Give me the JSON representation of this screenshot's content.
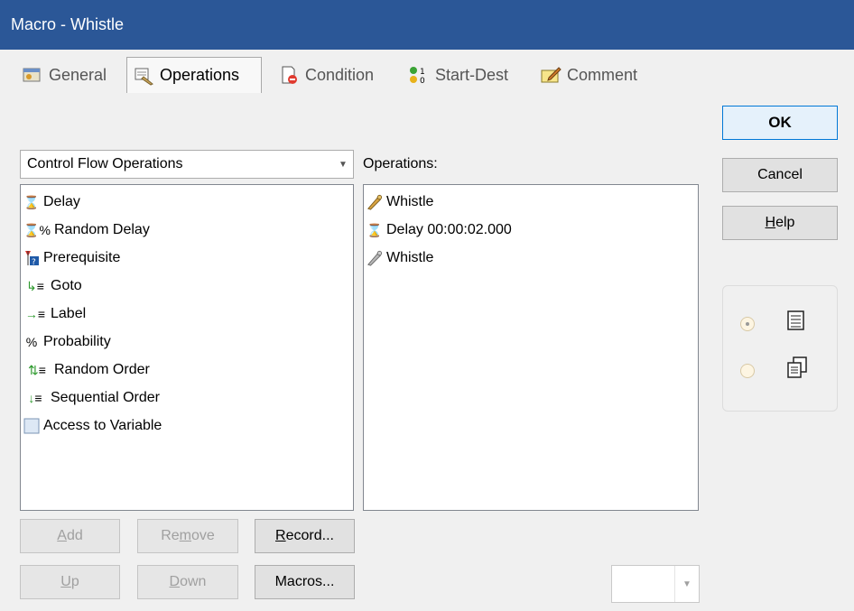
{
  "window": {
    "title": "Macro - Whistle"
  },
  "tabs": [
    {
      "label": "General",
      "icon": "general-icon"
    },
    {
      "label": "Operations",
      "icon": "operations-icon",
      "active": true
    },
    {
      "label": "Condition",
      "icon": "condition-icon"
    },
    {
      "label": "Start-Dest",
      "icon": "start-dest-icon"
    },
    {
      "label": "Comment",
      "icon": "comment-icon"
    }
  ],
  "category_combo": {
    "value": "Control Flow Operations"
  },
  "available_ops": [
    {
      "label": "Delay",
      "icon": "hourglass-icon"
    },
    {
      "label": "Random Delay",
      "icon": "random-delay-icon"
    },
    {
      "label": "Prerequisite",
      "icon": "prerequisite-icon"
    },
    {
      "label": "Goto",
      "icon": "goto-icon"
    },
    {
      "label": "Label",
      "icon": "label-icon"
    },
    {
      "label": "Probability",
      "icon": "percent-icon"
    },
    {
      "label": "Random Order",
      "icon": "random-order-icon"
    },
    {
      "label": "Sequential Order",
      "icon": "sequential-order-icon"
    },
    {
      "label": "Access to Variable",
      "icon": "variable-icon"
    }
  ],
  "operations_label": "Operations:",
  "operations": [
    {
      "label": "Whistle",
      "icon": "whistle-icon"
    },
    {
      "label": "Delay 00:00:02.000",
      "icon": "hourglass-icon"
    },
    {
      "label": "Whistle",
      "icon": "whistle-icon"
    }
  ],
  "buttons": {
    "ok": "OK",
    "cancel": "Cancel",
    "help_prefix": "",
    "help_mnemonic": "H",
    "help_rest": "elp",
    "add_mnemonic": "A",
    "add_rest": "dd",
    "remove_pre": "Re",
    "remove_mnemonic": "m",
    "remove_rest": "ove",
    "record_mnemonic": "R",
    "record_rest": "ecord...",
    "up_mnemonic": "U",
    "up_rest": "p",
    "down_mnemonic": "D",
    "down_rest": "own",
    "macros": "Macros..."
  },
  "view_mode": {
    "options": [
      {
        "icon": "list-view-icon",
        "selected": true
      },
      {
        "icon": "multi-page-view-icon",
        "selected": false
      }
    ]
  },
  "small_combo": {
    "value": ""
  }
}
